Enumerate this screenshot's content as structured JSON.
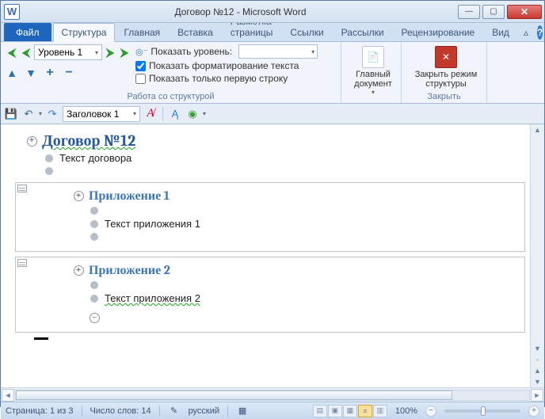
{
  "title": "Договор №12  -  Microsoft Word",
  "tabs": {
    "file": "Файл",
    "structure": "Структура",
    "home": "Главная",
    "insert": "Вставка",
    "layout": "Разметка страницы",
    "refs": "Ссылки",
    "mail": "Рассылки",
    "review": "Рецензирование",
    "view": "Вид"
  },
  "ribbon": {
    "level_value": "Уровень 1",
    "show_level_label": "Показать уровень:",
    "show_formatting": "Показать форматирование текста",
    "show_firstline": "Показать только первую строку",
    "group_tools": "Работа со структурой",
    "master_doc": "Главный документ",
    "close_btn": "Закрыть режим структуры",
    "close_group": "Закрыть"
  },
  "qat": {
    "style": "Заголовок 1"
  },
  "doc": {
    "h1": "Договор №12",
    "body1": "Текст договора",
    "app1": "Приложение 1",
    "app1_body": "Текст приложения  1",
    "app2": "Приложение 2",
    "app2_body": "Текст приложения 2"
  },
  "status": {
    "page": "Страница: 1 из 3",
    "words": "Число слов: 14",
    "lang": "русский",
    "zoom": "100%"
  }
}
